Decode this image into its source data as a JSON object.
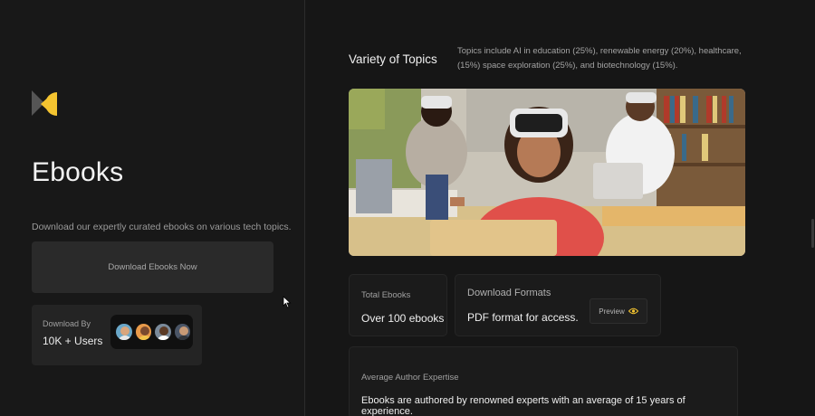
{
  "sidebar": {
    "logo": "ebooks-logo",
    "title": "Ebooks",
    "tagline": "Download our expertly curated ebooks on various tech topics.",
    "download_button": "Download Ebooks Now",
    "users_label": "Download By",
    "users_count": "10K + Users"
  },
  "topics": {
    "heading": "Variety of Topics",
    "description": "Topics include AI in education (25%), renewable energy (20%), healthcare, (15%) space exploration (25%), and biotechnology (15%)."
  },
  "hero_image": {
    "icon": "vr-classroom-photo"
  },
  "stats": {
    "total_label": "Total Ebooks",
    "total_value": "Over 100 ebooks",
    "formats_label": "Download Formats",
    "formats_value": "PDF format for access.",
    "preview_label": "Preview",
    "expertise_label": "Average Author Expertise",
    "expertise_value": "Ebooks are authored by renowned experts with an average of 15 years of experience."
  },
  "colors": {
    "accent": "#f4c430",
    "background": "#161616",
    "card": "#1b1b1b"
  }
}
